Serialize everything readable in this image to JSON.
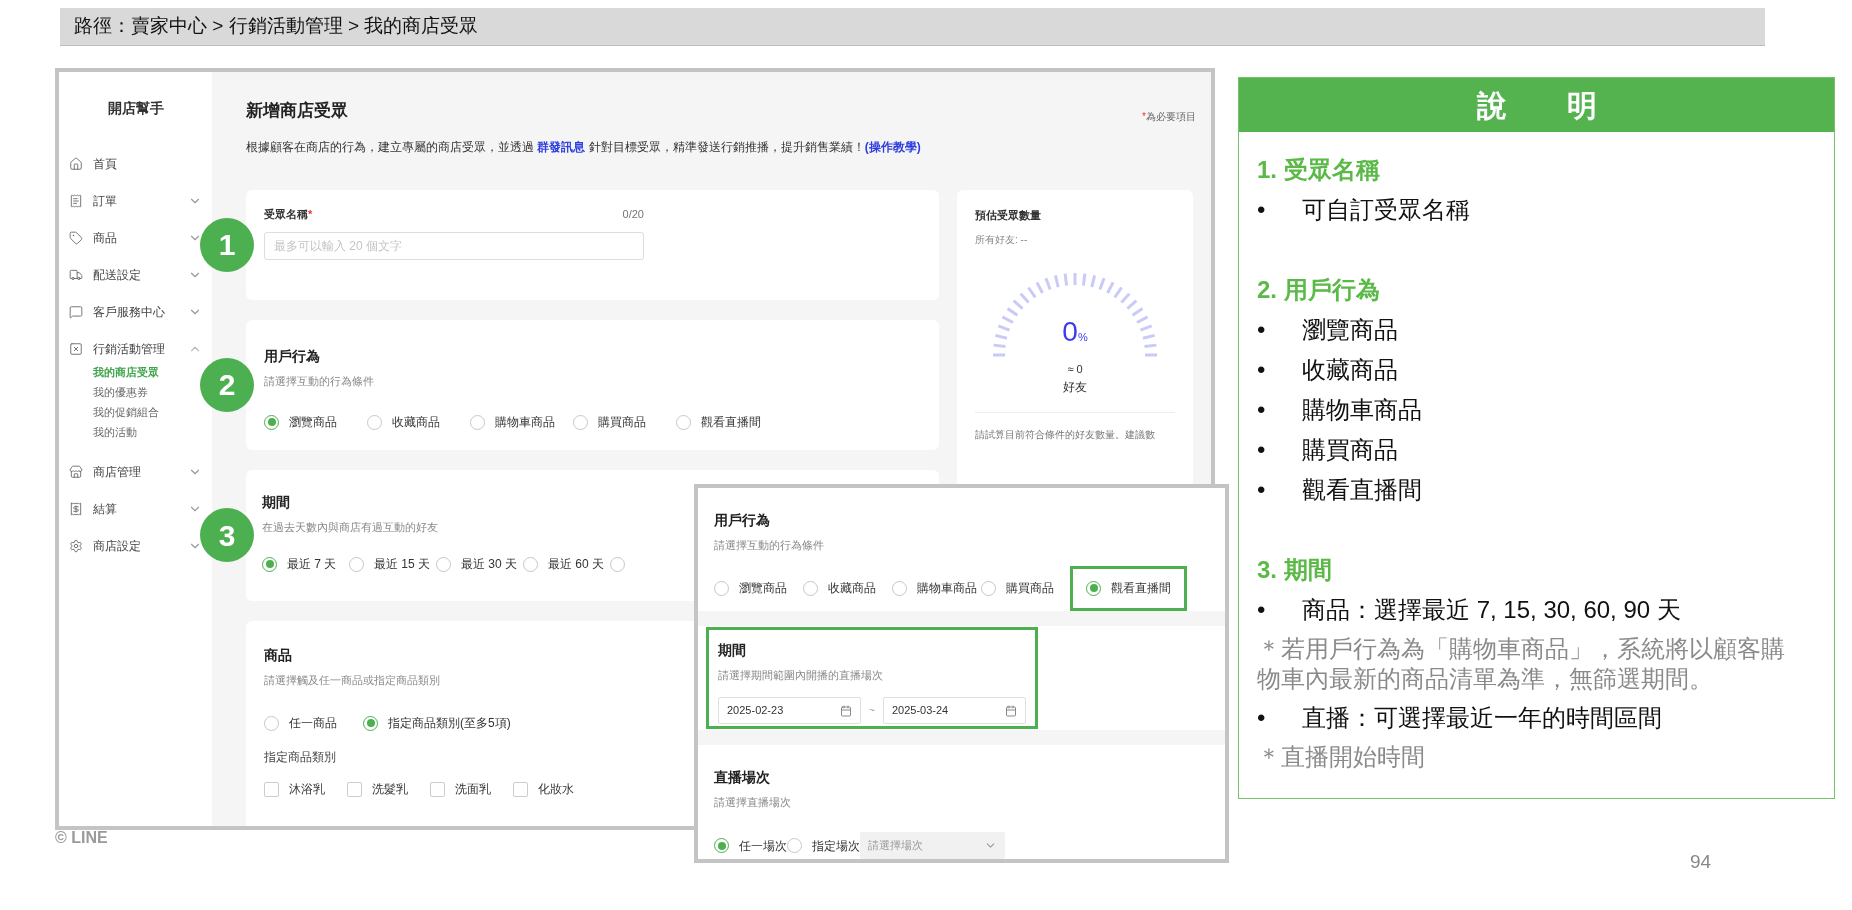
{
  "breadcrumb": "路徑：賣家中心 > 行銷活動管理 > 我的商店受眾",
  "app": {
    "sidebar": {
      "title": "開店幫手",
      "items": [
        {
          "label": "首頁",
          "kind": "link"
        },
        {
          "label": "訂單",
          "kind": "group",
          "expanded": false
        },
        {
          "label": "商品",
          "kind": "group",
          "expanded": false
        },
        {
          "label": "配送設定",
          "kind": "group",
          "expanded": false
        },
        {
          "label": "客戶服務中心",
          "kind": "group",
          "expanded": false
        },
        {
          "label": "行銷活動管理",
          "kind": "group",
          "expanded": true,
          "children": [
            {
              "label": "我的商店受眾",
              "selected": true
            },
            {
              "label": "我的優惠券",
              "selected": false
            },
            {
              "label": "我的促銷組合",
              "selected": false
            },
            {
              "label": "我的活動",
              "selected": false
            }
          ]
        },
        {
          "label": "商店管理",
          "kind": "group",
          "expanded": false
        },
        {
          "label": "結算",
          "kind": "group",
          "expanded": false
        },
        {
          "label": "商店設定",
          "kind": "group",
          "expanded": false
        }
      ]
    },
    "page": {
      "title": "新增商店受眾",
      "required_mark": "*",
      "required_note": "為必要項目",
      "description": [
        {
          "kind": "text",
          "text": "根據顧客在商店的行為，建立專屬的商店受眾，並透過 "
        },
        {
          "kind": "link",
          "text": "群發訊息"
        },
        {
          "kind": "text",
          "text": " 針對目標受眾，精準發送行銷推播，提升銷售業績！"
        },
        {
          "kind": "link",
          "text": "(操作教學)"
        }
      ]
    },
    "name_card": {
      "badge": "1",
      "label": "受眾名稱",
      "required_mark": "*",
      "counter": "0/20",
      "placeholder": "最多可以輸入 20 個文字"
    },
    "behavior_card": {
      "badge": "2",
      "title": "用戶行為",
      "subtitle": "請選擇互動的行為條件",
      "options": [
        {
          "label": "瀏覽商品",
          "selected": true
        },
        {
          "label": "收藏商品",
          "selected": false
        },
        {
          "label": "購物車商品",
          "selected": false
        },
        {
          "label": "購買商品",
          "selected": false
        },
        {
          "label": "觀看直播間",
          "selected": false
        }
      ]
    },
    "period_card": {
      "badge": "3",
      "title": "期間",
      "subtitle": "在過去天數內與商店有過互動的好友",
      "options": [
        {
          "label": "最近 7 天",
          "selected": true
        },
        {
          "label": "最近 15 天",
          "selected": false
        },
        {
          "label": "最近 30 天",
          "selected": false
        },
        {
          "label": "最近 60 天",
          "selected": false
        },
        {
          "selected": false
        }
      ]
    },
    "product_card": {
      "title": "商品",
      "subtitle": "請選擇觸及任一商品或指定商品類別",
      "options": [
        {
          "label": "任一商品",
          "selected": false
        },
        {
          "label": "指定商品類別(至多5項)",
          "selected": true
        }
      ],
      "category_label": "指定商品類別",
      "categories": [
        {
          "label": "沐浴乳",
          "checked": false
        },
        {
          "label": "洗髮乳",
          "checked": false
        },
        {
          "label": "洗面乳",
          "checked": false
        },
        {
          "label": "化妝水",
          "checked": false
        }
      ]
    },
    "estimate_card": {
      "title": "預估受眾數量",
      "all_friends": "所有好友: --",
      "percent": "0",
      "percent_unit": "%",
      "approx": "≈ 0",
      "unit": "好友",
      "note": "請試算目前符合條件的好友數量。建議數"
    }
  },
  "inset": {
    "behavior": {
      "title": "用戶行為",
      "subtitle": "請選擇互動的行為條件",
      "options": [
        {
          "label": "瀏覽商品",
          "selected": false,
          "highlighted": false
        },
        {
          "label": "收藏商品",
          "selected": false,
          "highlighted": false
        },
        {
          "label": "購物車商品",
          "selected": false,
          "highlighted": false
        },
        {
          "label": "購買商品",
          "selected": false,
          "highlighted": false
        },
        {
          "label": "觀看直播間",
          "selected": true,
          "highlighted": true
        }
      ]
    },
    "period": {
      "title": "期間",
      "subtitle": "請選擇期間範圍內開播的直播場次",
      "highlighted": true,
      "start": "2025-02-23",
      "separator": "~",
      "end": "2025-03-24"
    },
    "session": {
      "title": "直播場次",
      "subtitle": "請選擇直播場次",
      "options": [
        {
          "label": "任一場次",
          "selected": true
        },
        {
          "label": "指定場次",
          "selected": false
        }
      ],
      "select_placeholder": "請選擇場次",
      "select_disabled": true
    }
  },
  "explanation": {
    "title": "說　　明",
    "sections": [
      {
        "heading": "1. 受眾名稱",
        "items": [
          {
            "kind": "bullet",
            "marker": "•",
            "text": "可自訂受眾名稱"
          }
        ]
      },
      {
        "heading": "2. 用戶行為",
        "items": [
          {
            "kind": "bullet",
            "marker": "•",
            "text": "瀏覽商品"
          },
          {
            "kind": "bullet",
            "marker": "•",
            "text": "收藏商品"
          },
          {
            "kind": "bullet",
            "marker": "•",
            "text": "購物車商品"
          },
          {
            "kind": "bullet",
            "marker": "•",
            "text": "購買商品"
          },
          {
            "kind": "bullet",
            "marker": "•",
            "text": "觀看直播間"
          }
        ]
      },
      {
        "heading": "3. 期間",
        "items": [
          {
            "kind": "bullet",
            "marker": "•",
            "text": "商品：選擇最近 7, 15, 30, 60, 90 天"
          },
          {
            "kind": "note",
            "text": "＊若用戶行為為「購物車商品」，系統將以顧客購物車內最新的商品清單為準，無篩選期間。"
          },
          {
            "kind": "bullet",
            "marker": "•",
            "text": "直播：可選擇最近一年的時間區間"
          },
          {
            "kind": "note",
            "text": "＊直播開始時間"
          }
        ]
      }
    ]
  },
  "footer": {
    "logo": "© LINE",
    "page_number": "94"
  }
}
